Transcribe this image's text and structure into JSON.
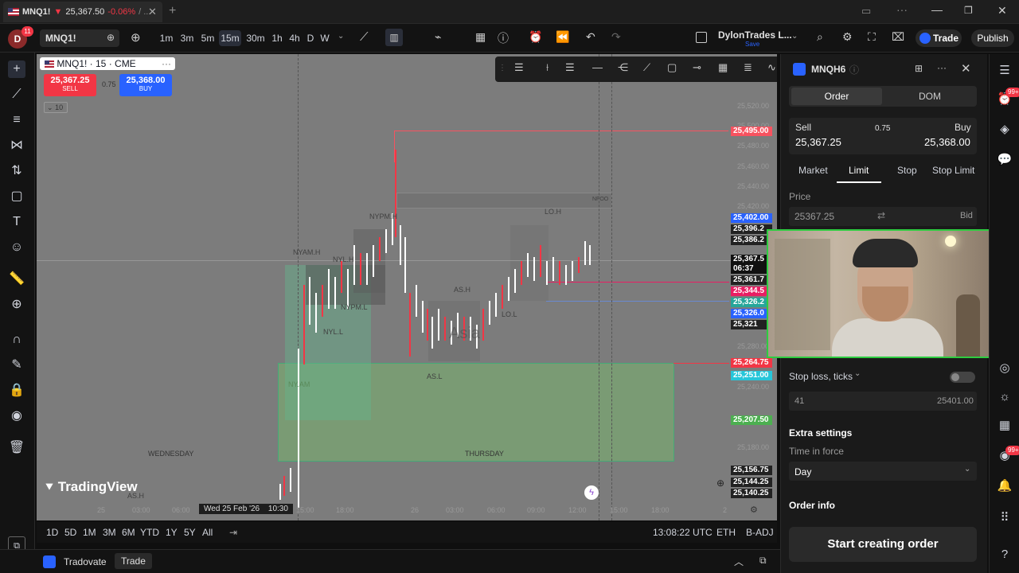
{
  "window": {
    "tab_title": "MNQ1!",
    "tab_price": "25,367.50",
    "tab_change": "-0.06%",
    "tab_suffix": "/ ..."
  },
  "topbar": {
    "avatar_letter": "D",
    "avatar_badge": "11",
    "symbol": "MNQ1!",
    "intervals": [
      "1m",
      "3m",
      "5m",
      "15m",
      "30m",
      "1h",
      "4h",
      "D",
      "W"
    ],
    "active_interval": "15m",
    "account": "DylonTrades L...",
    "account_sub": "Save",
    "trade_label": "Trade",
    "publish_label": "Publish"
  },
  "chart": {
    "legend_title": "MNQ1! · 15 · CME",
    "sell_price": "25,367.25",
    "sell_label": "SELL",
    "spread": "0.75",
    "buy_price": "25,368.00",
    "buy_label": "BUY",
    "qty": "10",
    "watermark": "TradingView",
    "day_labels": [
      "WEDNESDAY",
      "THURSDAY"
    ],
    "zone_labels": [
      "NYPM.H",
      "NYAM.H",
      "NYL.H",
      "NYPM.L",
      "NYL.L",
      "NY.AM",
      "AS.H",
      "AS.L",
      "LO.L",
      "LO.H",
      "Asia",
      "AS.H",
      "NFOO"
    ],
    "price_axis": [
      "25,520.00",
      "25,500.00",
      "25,480.00",
      "25,460.00",
      "25,440.00",
      "25,420.00",
      "25,280.00",
      "25,240.00",
      "25,180.00"
    ],
    "price_tags": [
      {
        "v": "25,495.00",
        "c": "#f7525f"
      },
      {
        "v": "25,402.00",
        "c": "#2962ff"
      },
      {
        "v": "25,396.2",
        "c": "#222"
      },
      {
        "v": "25,386.2",
        "c": "#222"
      },
      {
        "v": "25,367.5",
        "c": "#111"
      },
      {
        "v": "06:37",
        "c": "#111"
      },
      {
        "v": "25,361.7",
        "c": "#222"
      },
      {
        "v": "25,344.5",
        "c": "#e91e63"
      },
      {
        "v": "25,326.2",
        "c": "#26a69a"
      },
      {
        "v": "25,326.0",
        "c": "#2962ff"
      },
      {
        "v": "25,321",
        "c": "#222"
      },
      {
        "v": "25,264.75",
        "c": "#f23645"
      },
      {
        "v": "25,251.00",
        "c": "#26c6da"
      },
      {
        "v": "25,207.50",
        "c": "#4caf50"
      },
      {
        "v": "25,156.75",
        "c": "#222"
      },
      {
        "v": "25,144.25",
        "c": "#222"
      },
      {
        "v": "25,140.25",
        "c": "#222"
      }
    ],
    "time_axis": [
      "25",
      "03:00",
      "06:00",
      "Wed 25 Feb '26",
      "10:30",
      "15:00",
      "18:00",
      "26",
      "03:00",
      "06:00",
      "09:00",
      "12:00",
      "15:00",
      "18:00",
      "2"
    ]
  },
  "bottombar": {
    "ranges": [
      "1D",
      "5D",
      "1M",
      "3M",
      "6M",
      "YTD",
      "1Y",
      "5Y",
      "All"
    ],
    "clock": "13:08:22 UTC",
    "exchange": "ETH",
    "adj": "B-ADJ"
  },
  "tradebar": {
    "broker": "Tradovate",
    "trade": "Trade"
  },
  "panel": {
    "symbol": "MNQH6",
    "tabs": [
      "Order",
      "DOM"
    ],
    "sell_label": "Sell",
    "sell_price": "25,367.25",
    "spread": "0.75",
    "buy_label": "Buy",
    "buy_price": "25,368.00",
    "order_types": [
      "Market",
      "Limit",
      "Stop",
      "Stop Limit"
    ],
    "active_type": "Limit",
    "price_label": "Price",
    "price_value": "25367.25",
    "price_ref": "Bid",
    "stoploss_label": "Stop loss, ticks",
    "stoploss_value": "41",
    "stoploss_price": "25401.00",
    "extra_label": "Extra settings",
    "tif_label": "Time in force",
    "tif_value": "Day",
    "order_info": "Order info",
    "submit": "Start creating order"
  },
  "farright": {
    "badge1": "99+",
    "badge2": "99+"
  }
}
